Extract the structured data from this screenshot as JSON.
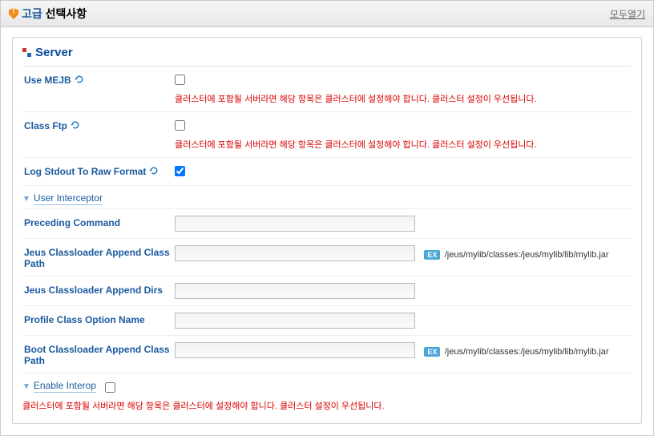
{
  "header": {
    "title_adv": "고급",
    "title_sel": "선택사항",
    "open_all": "모두열기"
  },
  "panel": {
    "title": "Server",
    "rows": {
      "use_mejb": {
        "label": "Use MEJB",
        "note": "클러스터에 포함될 서버라면 해당 항목은 클러스터에 설정해야 합니다. 클러스터 설정이 우선됩니다.",
        "checked": false
      },
      "class_ftp": {
        "label": "Class Ftp",
        "note": "클러스터에 포함될 서버라면 해당 항목은 클러스터에 설정해야 합니다. 클러스터 설정이 우선됩니다.",
        "checked": false
      },
      "log_stdout": {
        "label": "Log Stdout To Raw Format",
        "checked": true
      }
    },
    "section_user_interceptor": {
      "label": "User Interceptor"
    },
    "fields": {
      "preceding_command": {
        "label": "Preceding Command",
        "value": ""
      },
      "jeus_append_classpath": {
        "label": "Jeus Classloader Append Class Path",
        "value": "",
        "ex": "/jeus/mylib/classes:/jeus/mylib/lib/mylib.jar"
      },
      "jeus_append_dirs": {
        "label": "Jeus Classloader Append Dirs",
        "value": ""
      },
      "profile_class_option": {
        "label": "Profile Class Option Name",
        "value": ""
      },
      "boot_append_classpath": {
        "label": "Boot Classloader Append Class Path",
        "value": "",
        "ex": "/jeus/mylib/classes:/jeus/mylib/lib/mylib.jar"
      }
    },
    "section_enable_interop": {
      "label": "Enable Interop",
      "checked": false,
      "note": "클러스터에 포함될 서버라면 해당 항목은 클러스터에 설정해야 합니다. 클러스터 설정이 우선됩니다."
    }
  },
  "ex_tag": "EX"
}
